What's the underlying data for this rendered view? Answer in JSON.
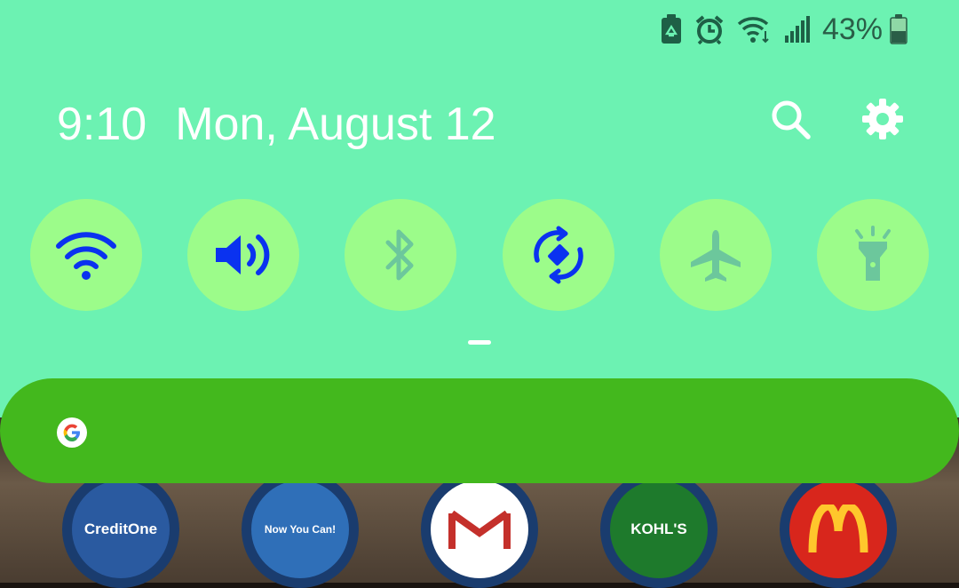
{
  "status_bar": {
    "battery_percent": "43%",
    "icons": [
      "battery-saver-icon",
      "alarm-icon",
      "wifi-data-icon",
      "cellular-signal-icon",
      "battery-icon"
    ]
  },
  "header": {
    "time": "9:10",
    "date": "Mon, August 12",
    "actions": [
      "search-icon",
      "gear-icon"
    ]
  },
  "quick_settings": [
    {
      "id": "wifi",
      "icon": "wifi-icon",
      "active": true
    },
    {
      "id": "sound",
      "icon": "volume-icon",
      "active": true
    },
    {
      "id": "bluetooth",
      "icon": "bluetooth-icon",
      "active": false
    },
    {
      "id": "auto-rotate",
      "icon": "auto-rotate-icon",
      "active": true
    },
    {
      "id": "airplane",
      "icon": "airplane-icon",
      "active": false
    },
    {
      "id": "flashlight",
      "icon": "flashlight-icon",
      "active": false
    }
  ],
  "search": {
    "icon": "google-icon"
  },
  "home_apps": [
    {
      "id": "creditone",
      "label": "CreditOne"
    },
    {
      "id": "wallet",
      "label": "Now You Can!"
    },
    {
      "id": "gmail",
      "label": ""
    },
    {
      "id": "kohls",
      "label": "KOHL'S"
    },
    {
      "id": "mcdonalds",
      "label": ""
    }
  ],
  "colors": {
    "panel_bg": "#6cf2b2",
    "tile_bg": "#9cfc8a",
    "active_icon": "#0a32f0",
    "inactive_icon": "#6cc79c",
    "search_bg": "#43b81d"
  }
}
